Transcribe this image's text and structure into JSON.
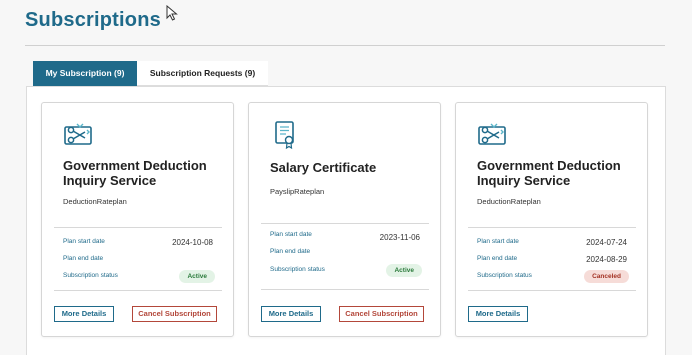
{
  "page": {
    "title": "Subscriptions"
  },
  "tabs": [
    {
      "label": "My Subscription (9)",
      "active": true
    },
    {
      "label": "Subscription Requests (9)",
      "active": false
    }
  ],
  "colors": {
    "accent": "#1f6a8a",
    "active_badge": "#2a7a3b",
    "canceled_badge": "#a33224"
  },
  "field_labels": {
    "start": "Plan start date",
    "end": "Plan end date",
    "status": "Subscription status"
  },
  "buttons": {
    "details": "More Details",
    "cancel": "Cancel Subscription"
  },
  "cards": [
    {
      "icon": "scissors-ticket-icon",
      "title": "Government Deduction Inquiry Service",
      "rateplan": "DeductionRateplan",
      "start_date": "2024-10-08",
      "end_date": "",
      "status": "Active"
    },
    {
      "icon": "certificate-icon",
      "title": "Salary Certificate",
      "rateplan": "PayslipRateplan",
      "start_date": "2023-11-06",
      "end_date": "",
      "status": "Active"
    },
    {
      "icon": "scissors-ticket-icon",
      "title": "Government Deduction Inquiry Service",
      "rateplan": "DeductionRateplan",
      "start_date": "2024-07-24",
      "end_date": "2024-08-29",
      "status": "Canceled"
    }
  ]
}
